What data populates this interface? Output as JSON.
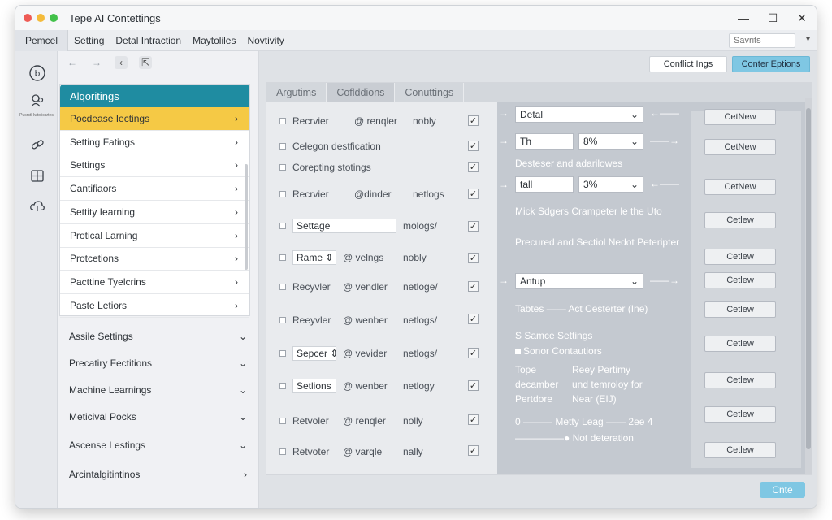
{
  "window": {
    "title": "Tepe AI Contettings"
  },
  "menubar": {
    "items": [
      "Pemcel",
      "Setting",
      "Detal Intraction",
      "Maytoliles",
      "Novtivity"
    ],
    "search_placeholder": "Savrits"
  },
  "iconbar": {
    "icon_label": "Pusrctl Iwtolicartes"
  },
  "sidebar": {
    "algorithms_header": "Alqoritings",
    "items": [
      {
        "label": "Pocdease Iectings",
        "selected": true
      },
      {
        "label": "Setting Fatings"
      },
      {
        "label": "Settings"
      },
      {
        "label": "Cantifiaors"
      },
      {
        "label": "Settity Iearning"
      },
      {
        "label": "Protical Larning"
      },
      {
        "label": "Protcetions"
      },
      {
        "label": "Pacttine Tyelcrins"
      },
      {
        "label": "Paste Letiors"
      }
    ],
    "sections": [
      {
        "label": "Assile Settings",
        "icon": "chevron-down"
      },
      {
        "label": "Precatiry Fectitions",
        "icon": "chevron-down"
      },
      {
        "label": "Machine Learnings",
        "icon": "chevron-down"
      },
      {
        "label": "Meticival Pocks",
        "icon": "chevron-down"
      },
      {
        "label": "Ascense Lestings",
        "icon": "chevron-down"
      },
      {
        "label": "Arcintalgitintinos",
        "icon": "chevron-right"
      }
    ]
  },
  "toolbar": {
    "conflict_label": "Conflict Ings",
    "options_label": "Conter Eptions"
  },
  "tabs": [
    "Argutims",
    "Coflddions",
    "Conuttings"
  ],
  "left_rows": [
    {
      "a": "Recrvier",
      "b": "@ renqler",
      "c": "nobly",
      "checked": true
    },
    {
      "a": "Celegon destfication",
      "checked": true
    },
    {
      "a": "Corepting stotings",
      "checked": true
    },
    {
      "a": "Recrvier",
      "b": "@dinder",
      "c": "netlogs",
      "checked": true
    },
    {
      "field": "Settage",
      "c": "mologs/",
      "checked": true
    },
    {
      "field": "Rame",
      "b": "@ velngs",
      "c": "nobly",
      "checked": true
    },
    {
      "a": "Recyvler",
      "b": "@ vendler",
      "c": "netloge/",
      "checked": true
    },
    {
      "a": "Reeyvler",
      "b": "@ wenber",
      "c": "netlogs/",
      "checked": true
    },
    {
      "field": "Sepcer",
      "b": "@ vevider",
      "c": "netlogs/",
      "checked": true
    },
    {
      "field": "Setlions",
      "b": "@ wenber",
      "c": "netlogy",
      "checked": true
    },
    {
      "a": "Retvoler",
      "b": "@ renqler",
      "c": "nolly",
      "checked": true
    },
    {
      "a": "Retvoter",
      "b": "@ varqle",
      "c": "nally",
      "checked": true
    }
  ],
  "right_panel": {
    "detal": "Detal",
    "th": "Th",
    "th_pct": "8%",
    "desc1": "Desteser and adarilowes",
    "tall": "tall",
    "tall_pct": "3%",
    "desc2": "Mick Sdgers Crampeter le the Uto",
    "desc3": "Precured and Sectiol Nedot Peteripter",
    "antup": "Antup",
    "tables_a": "Tabtes",
    "tables_b": "Act Cesterter (Ine)",
    "samce": "S Samce Settings",
    "sonor": "Sonor Contautiors",
    "tope": "Tope",
    "decamber": "decamber",
    "pertdore": "Pertdore",
    "reey1": "Reey Pertimy",
    "reey2": "und temroloy for",
    "reey3": "Near (EIJ)",
    "zero": "0",
    "metty": "Metty Leag",
    "zee": "2ee 4",
    "not": "Not deteration",
    "get_buttons": [
      "CetNew",
      "CetNew",
      "CetNew",
      "Cetlew",
      "Cetlew",
      "Cetlew",
      "Cetlew",
      "Cetlew",
      "Cetlew",
      "Cetlew",
      "Cetlew"
    ]
  },
  "footer": {
    "done_label": "Cnte"
  }
}
